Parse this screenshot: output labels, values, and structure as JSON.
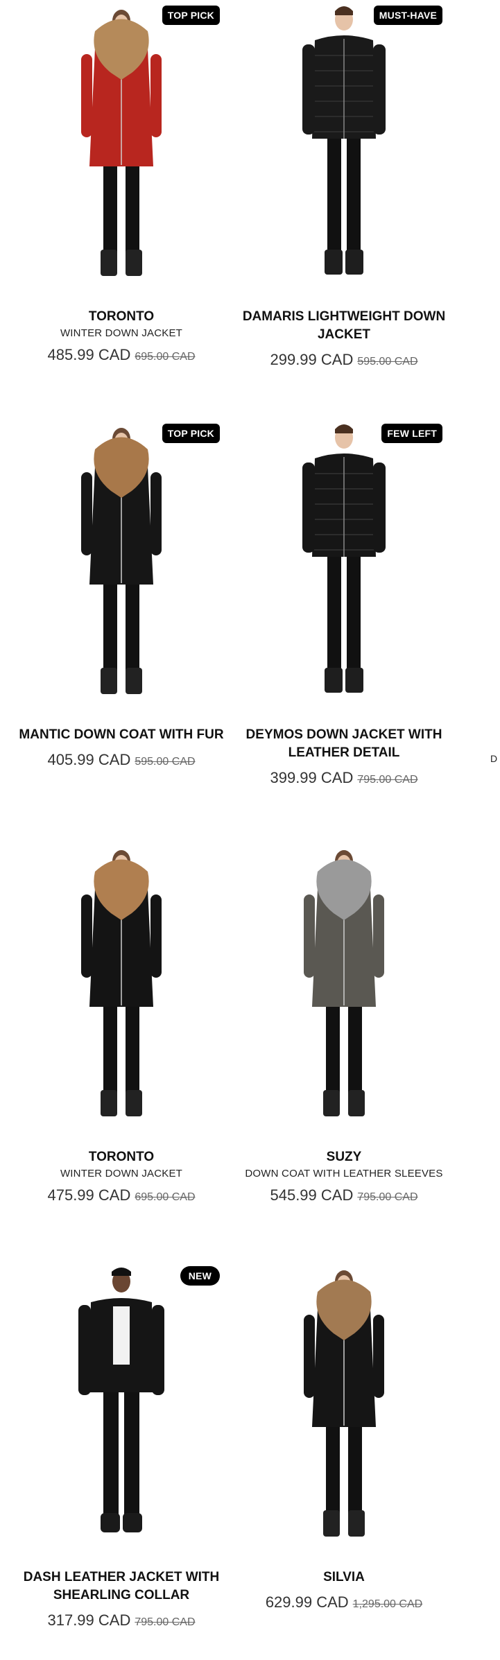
{
  "products": [
    {
      "name": "TORONTO",
      "subtitle": "WINTER DOWN JACKET",
      "price": "485.99 CAD",
      "original_price": "695.00 CAD",
      "badge": "TOP PICK",
      "coat_color": "#b8261f",
      "fur": "#b58a5a",
      "figure": "female-long"
    },
    {
      "name": "DAMARIS LIGHTWEIGHT DOWN JACKET",
      "subtitle": "",
      "price": "299.99 CAD",
      "original_price": "595.00 CAD",
      "badge": "MUST-HAVE",
      "coat_color": "#1a1a1a",
      "fur": "",
      "figure": "male-puffer"
    },
    {
      "name": "MANTIC DOWN COAT WITH FUR",
      "subtitle": "",
      "price": "405.99 CAD",
      "original_price": "595.00 CAD",
      "badge": "TOP PICK",
      "coat_color": "#161616",
      "fur": "#a8784a",
      "figure": "female-long"
    },
    {
      "name": "DEYMOS DOWN JACKET WITH LEATHER DETAIL",
      "subtitle": "",
      "price": "399.99 CAD",
      "original_price": "795.00 CAD",
      "badge": "FEW LEFT",
      "coat_color": "#161616",
      "fur": "",
      "figure": "male-puffer"
    },
    {
      "name": "TORONTO",
      "subtitle": "WINTER DOWN JACKET",
      "price": "475.99 CAD",
      "original_price": "695.00 CAD",
      "badge": "",
      "coat_color": "#141414",
      "fur": "#b07f50",
      "figure": "female-long"
    },
    {
      "name": "SUZY",
      "subtitle": "DOWN COAT WITH LEATHER SLEEVES",
      "price": "545.99 CAD",
      "original_price": "795.00 CAD",
      "badge": "",
      "coat_color": "#5a5852",
      "fur": "#9a9a9a",
      "figure": "female-long"
    },
    {
      "name": "DASH LEATHER JACKET WITH SHEARLING COLLAR",
      "subtitle": "",
      "price": "317.99 CAD",
      "original_price": "795.00 CAD",
      "badge": "NEW",
      "coat_color": "#151515",
      "fur": "",
      "figure": "male-jacket"
    },
    {
      "name": "SILVIA",
      "subtitle": "",
      "price": "629.99 CAD",
      "original_price": "1,295.00 CAD",
      "badge": "",
      "coat_color": "#151515",
      "fur": "#a27a52",
      "figure": "female-long"
    }
  ],
  "edge_text": "D"
}
